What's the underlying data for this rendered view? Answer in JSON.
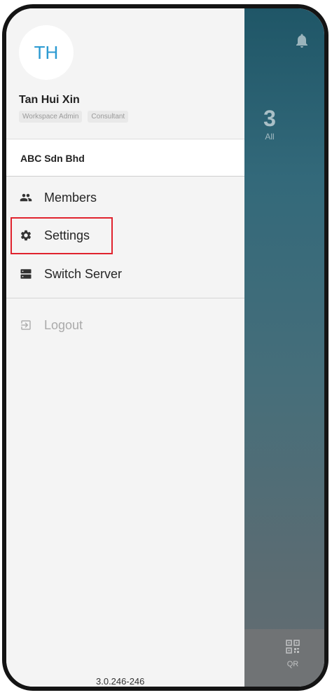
{
  "user": {
    "initials": "TH",
    "name": "Tan Hui Xin",
    "roles": [
      "Workspace Admin",
      "Consultant"
    ]
  },
  "workspace": {
    "name": "ABC Sdn Bhd"
  },
  "menu": {
    "members": "Members",
    "settings": "Settings",
    "switch_server": "Switch Server",
    "logout": "Logout"
  },
  "background_app": {
    "count": "3",
    "count_label": "All",
    "qr_label": "QR"
  },
  "version": "3.0.246-246",
  "icons": {
    "bell": "bell-icon",
    "members": "people-icon",
    "settings": "gear-icon",
    "switch_server": "server-icon",
    "logout": "logout-icon",
    "qr": "qr-code-icon"
  },
  "colors": {
    "accent": "#2b9ad1",
    "highlight": "#e0232e",
    "background_teal": "#1f5667"
  }
}
